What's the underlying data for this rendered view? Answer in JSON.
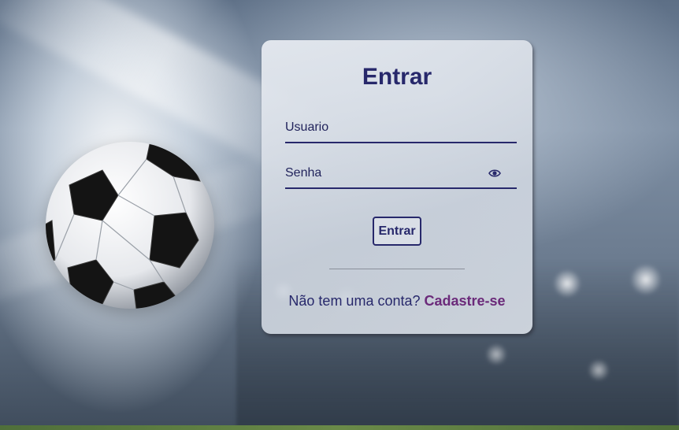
{
  "login": {
    "title": "Entrar",
    "username_placeholder": "Usuario",
    "password_placeholder": "Senha",
    "toggle_password_icon": "eye-icon",
    "submit_label": "Entrar",
    "signup_prompt": "Não tem uma conta?",
    "signup_link": "Cadastre-se"
  },
  "colors": {
    "primary": "#27286b",
    "link": "#6b2a7a"
  }
}
